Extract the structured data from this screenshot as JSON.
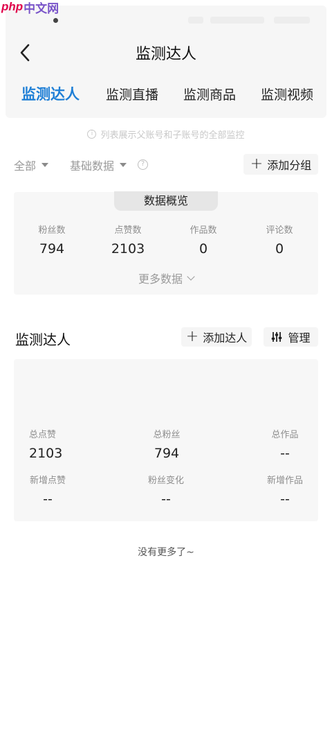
{
  "watermark": {
    "php": "php",
    "cn": "中文网"
  },
  "nav": {
    "title": "监测达人"
  },
  "tabs": [
    {
      "label": "监测达人",
      "active": true
    },
    {
      "label": "监测直播",
      "active": false
    },
    {
      "label": "监测商品",
      "active": false
    },
    {
      "label": "监测视频",
      "active": false
    }
  ],
  "notice": "列表展示父账号和子账号的全部监控",
  "filters": {
    "all": "全部",
    "basic": "基础数据",
    "add_group": "添加分组"
  },
  "overview": {
    "tag": "数据概览",
    "stats": [
      {
        "label": "粉丝数",
        "value": "794"
      },
      {
        "label": "点赞数",
        "value": "2103"
      },
      {
        "label": "作品数",
        "value": "0"
      },
      {
        "label": "评论数",
        "value": "0"
      }
    ],
    "more": "更多数据"
  },
  "section": {
    "title": "监测达人",
    "add_expert": "添加达人",
    "manage": "管理"
  },
  "expert": {
    "row1": [
      {
        "label": "总点赞",
        "value": "2103"
      },
      {
        "label": "总粉丝",
        "value": "794"
      },
      {
        "label": "总作品",
        "value": "--"
      }
    ],
    "row2": [
      {
        "label": "新增点赞",
        "value": "--"
      },
      {
        "label": "粉丝变化",
        "value": "--"
      },
      {
        "label": "新增作品",
        "value": "--"
      }
    ]
  },
  "footer": {
    "end_text": "没有更多了~"
  },
  "colors": {
    "accent": "#1f7fd6"
  }
}
